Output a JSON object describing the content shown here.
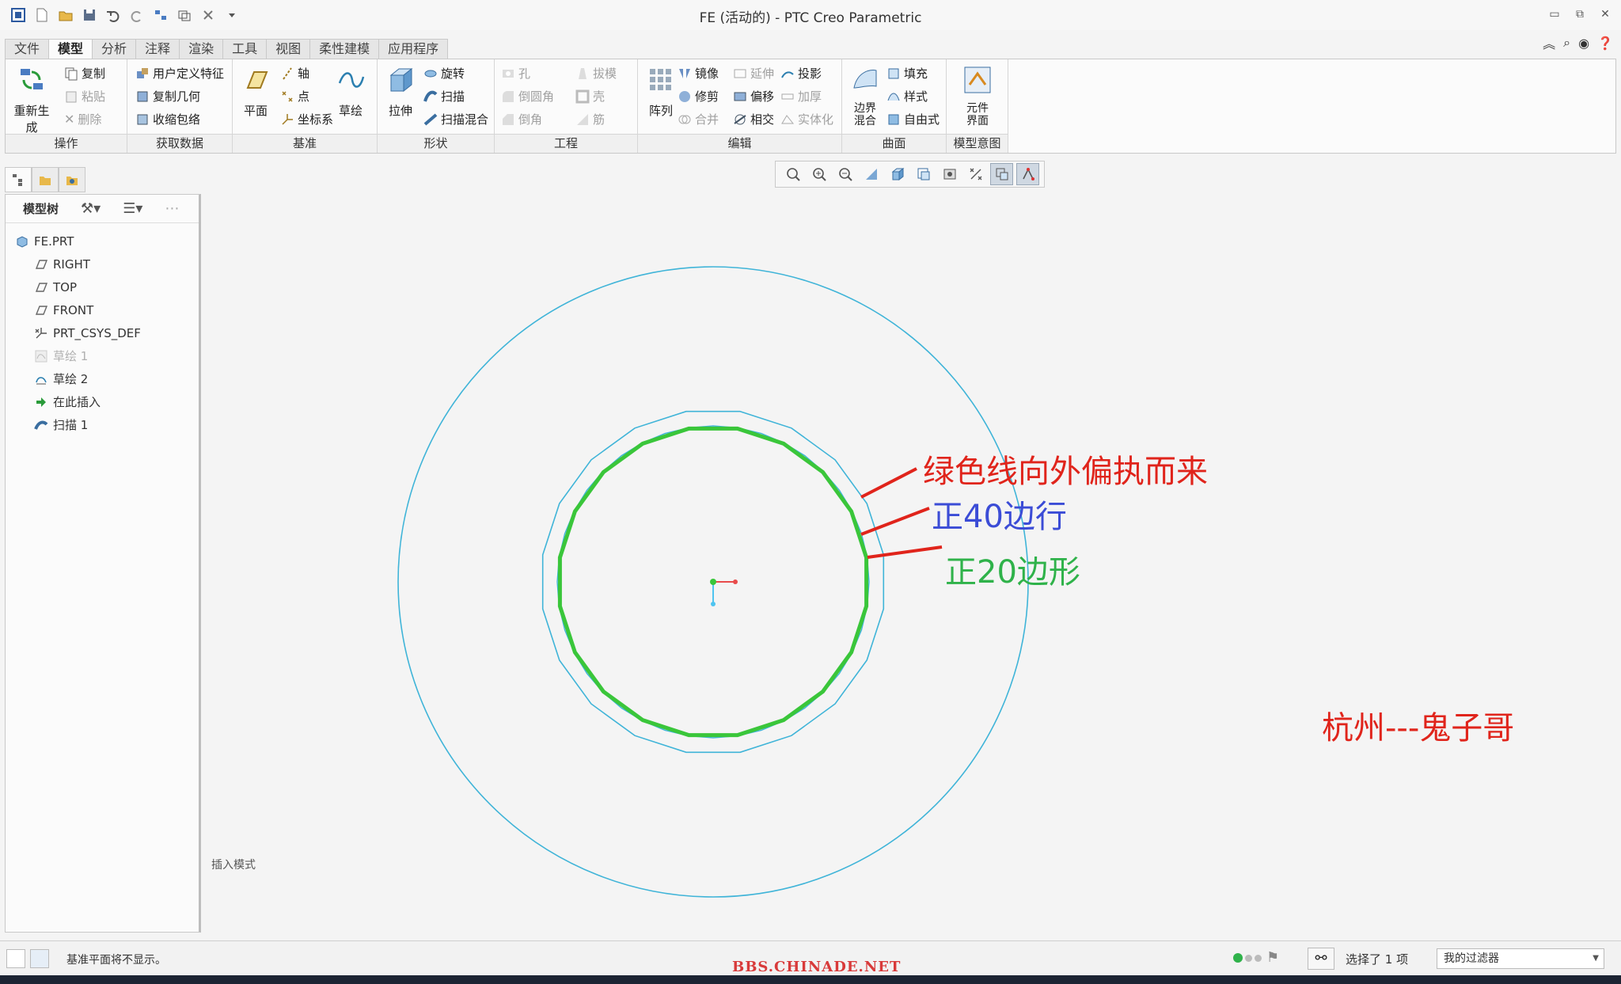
{
  "window": {
    "title": "FE (活动的) - PTC Creo Parametric",
    "controls": [
      "minimize-icon",
      "restore-icon",
      "close-icon"
    ]
  },
  "tabs": [
    "文件",
    "模型",
    "分析",
    "注释",
    "渲染",
    "工具",
    "视图",
    "柔性建模",
    "应用程序"
  ],
  "active_tab": "模型",
  "ribbon": {
    "operations": {
      "label": "操作",
      "regenerate": "重新生成",
      "copy": "复制",
      "paste": "粘贴",
      "delete": "删除"
    },
    "get_data": {
      "label": "获取数据",
      "udf": "用户定义特征",
      "copy_geom": "复制几何",
      "shrinkwrap": "收缩包络"
    },
    "datum": {
      "label": "基准",
      "plane": "平面",
      "axis": "轴",
      "point": "点",
      "csys": "坐标系",
      "sketch": "草绘"
    },
    "shapes": {
      "label": "形状",
      "extrude": "拉伸",
      "revolve": "旋转",
      "sweep": "扫描",
      "swept_blend": "扫描混合"
    },
    "engineering": {
      "label": "工程",
      "hole": "孔",
      "round": "倒圆角",
      "chamfer": "倒角",
      "draft": "拔模",
      "shell": "壳",
      "rib": "筋"
    },
    "editing": {
      "label": "编辑",
      "pattern": "阵列",
      "mirror": "镜像",
      "trim": "修剪",
      "merge": "合并",
      "extend": "延伸",
      "offset": "偏移",
      "intersect": "相交",
      "project": "投影",
      "thicken": "加厚",
      "solidify": "实体化"
    },
    "surfaces": {
      "label": "曲面",
      "boundary_blend": "边界混合",
      "fill": "填充",
      "style": "样式",
      "freestyle": "自由式"
    },
    "model_intent": {
      "label": "模型意图",
      "component_interface": "元件界面"
    }
  },
  "model_tree": {
    "title": "模型树",
    "items": [
      {
        "label": "FE.PRT",
        "icon": "part-icon",
        "disabled": false
      },
      {
        "label": "RIGHT",
        "icon": "datum-plane-icon",
        "disabled": false
      },
      {
        "label": "TOP",
        "icon": "datum-plane-icon",
        "disabled": false
      },
      {
        "label": "FRONT",
        "icon": "datum-plane-icon",
        "disabled": false
      },
      {
        "label": "PRT_CSYS_DEF",
        "icon": "csys-icon",
        "disabled": false
      },
      {
        "label": "草绘 1",
        "icon": "sketch-icon",
        "disabled": true
      },
      {
        "label": "草绘 2",
        "icon": "sketch-icon",
        "disabled": false
      },
      {
        "label": "在此插入",
        "icon": "insert-arrow-icon",
        "disabled": false
      },
      {
        "label": "扫描 1",
        "icon": "sweep-icon",
        "disabled": false
      }
    ]
  },
  "graphics": {
    "mode_label": "插入模式",
    "annotations": {
      "green_offset": "绿色线向外偏执而来",
      "polygon_40": "正40边行",
      "polygon_20": "正20边形",
      "author": "杭州---鬼子哥"
    },
    "colors": {
      "sketch_blue": "#3fb4d8",
      "selection_green": "#3ac63a",
      "annotation_red": "#e0241b",
      "annotation_blue": "#3b4cd6",
      "annotation_green": "#2fb24a"
    }
  },
  "status": {
    "message": "基准平面将不显示。",
    "selection": "选择了 1 项",
    "filter": "我的过滤器",
    "watermark": "BBS.CHINADE.NET"
  }
}
